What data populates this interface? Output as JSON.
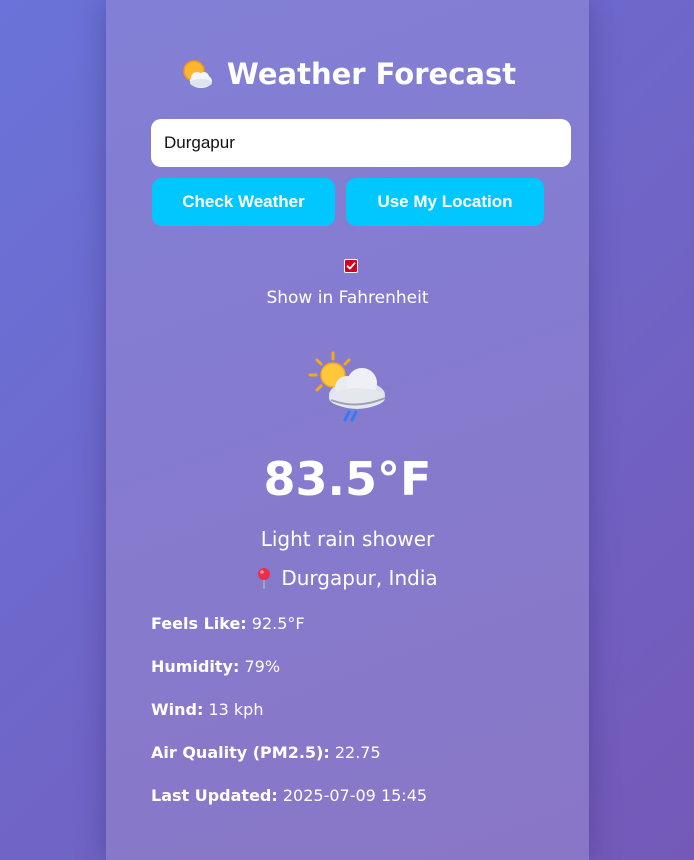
{
  "header": {
    "title": "Weather Forecast",
    "title_icon": "sun-behind-cloud-icon"
  },
  "search": {
    "value": "Durgapur"
  },
  "buttons": {
    "check_weather": "Check Weather",
    "use_location": "Use My Location"
  },
  "unit_toggle": {
    "label": "Show in Fahrenheit",
    "checked": true,
    "accent_color": "#d40020"
  },
  "weather": {
    "icon": "sun-behind-rain-cloud-icon",
    "temperature": "83.5°F",
    "condition": "Light rain shower",
    "location_icon": "pin-icon",
    "location": "Durgapur, India"
  },
  "details": [
    {
      "label": "Feels Like:",
      "value": "92.5°F"
    },
    {
      "label": "Humidity:",
      "value": "79%"
    },
    {
      "label": "Wind:",
      "value": "13 kph"
    },
    {
      "label": "Air Quality (PM2.5):",
      "value": "22.75"
    },
    {
      "label": "Last Updated:",
      "value": "2025-07-09 15:45"
    }
  ],
  "colors": {
    "button_bg": "#00c8ff",
    "card_bg": "#8180d6",
    "page_bg": "#6a73d9"
  }
}
